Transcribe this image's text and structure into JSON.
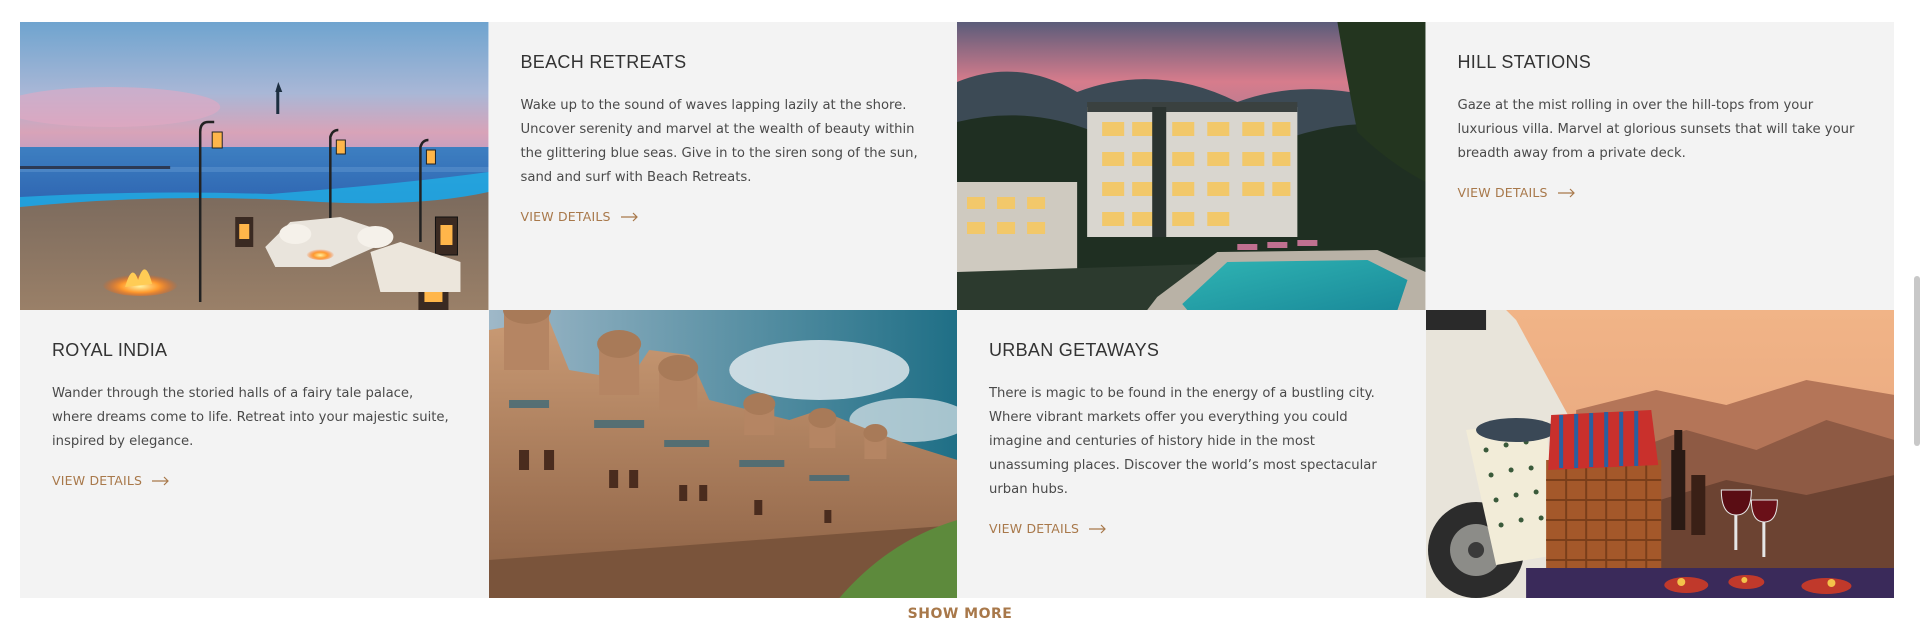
{
  "cards": [
    {
      "title": "BEACH RETREATS",
      "description": "Wake up to the sound of waves lapping lazily at the shore. Uncover serenity and marvel at the wealth of beauty within the glittering blue seas. Give in to the siren song of the sun, sand and surf with Beach Retreats.",
      "link_label": "VIEW DETAILS"
    },
    {
      "title": "HILL STATIONS",
      "description": "Gaze at the mist rolling in over the hill-tops from your luxurious villa. Marvel at glorious sunsets that will take your breadth away from a private deck.",
      "link_label": "VIEW DETAILS"
    },
    {
      "title": "ROYAL INDIA",
      "description": "Wander through the storied halls of a fairy tale palace, where dreams come to life. Retreat into your majestic suite, inspired by elegance.",
      "link_label": "VIEW DETAILS"
    },
    {
      "title": "URBAN GETAWAYS",
      "description": "There is magic to be found in the energy of a bustling city. Where vibrant markets offer you everything you could imagine and centuries of history hide in the most unassuming places. Discover the world’s most spectacular urban hubs.",
      "link_label": "VIEW DETAILS"
    }
  ],
  "show_more_label": "SHOW MORE",
  "icons": {
    "link_arrow": "arrow-right-icon"
  },
  "colors": {
    "accent": "#a8784a",
    "card_bg": "#f3f3f3",
    "title": "#333333",
    "body_text": "#4a4a4a"
  }
}
